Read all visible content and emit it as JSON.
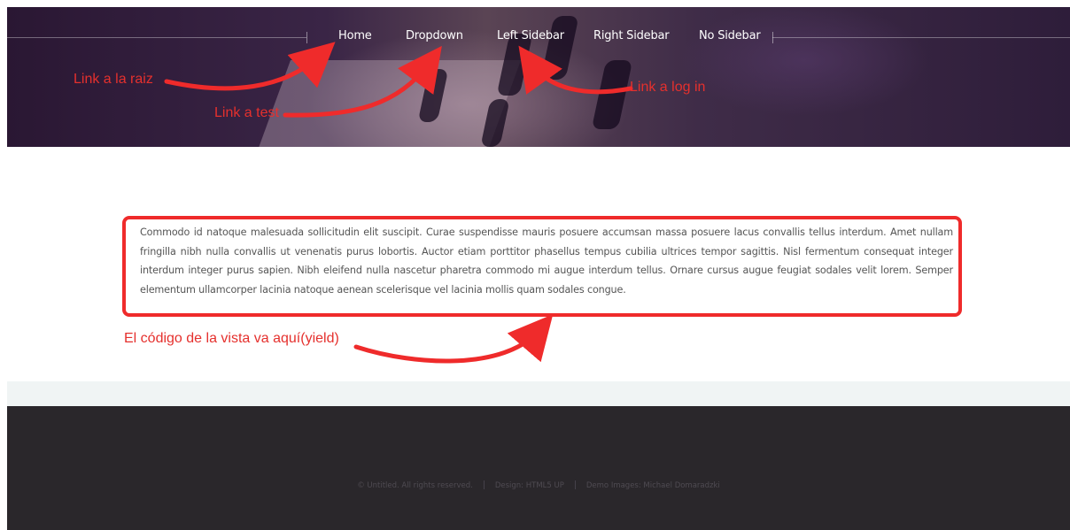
{
  "nav": {
    "items": [
      "Home",
      "Dropdown",
      "Left Sidebar",
      "Right Sidebar",
      "No Sidebar"
    ]
  },
  "annotations": {
    "root": "Link a la raiz",
    "test": "Link a test",
    "login": "Link a log in",
    "yield": "El código de la vista va aquí(yield)"
  },
  "content": {
    "paragraph": "Commodo id natoque malesuada sollicitudin elit suscipit. Curae suspendisse mauris posuere accumsan massa posuere lacus convallis tellus interdum. Amet nullam fringilla nibh nulla convallis ut venenatis purus lobortis. Auctor etiam porttitor phasellus tempus cubilia ultrices tempor sagittis. Nisl fermentum consequat integer interdum integer purus sapien. Nibh eleifend nulla nascetur pharetra commodo mi augue interdum tellus. Ornare cursus augue feugiat sodales velit lorem. Semper elementum ullamcorper lacinia natoque aenean scelerisque vel lacinia mollis quam sodales congue."
  },
  "footer": {
    "copyright": "© Untitled. All rights reserved.",
    "design": "Design: HTML5 UP",
    "images": "Demo Images: Michael Domaradzki"
  },
  "colors": {
    "annotation": "#e5302d",
    "footer_bg": "#2a272b",
    "band_bg": "#f0f4f4"
  }
}
